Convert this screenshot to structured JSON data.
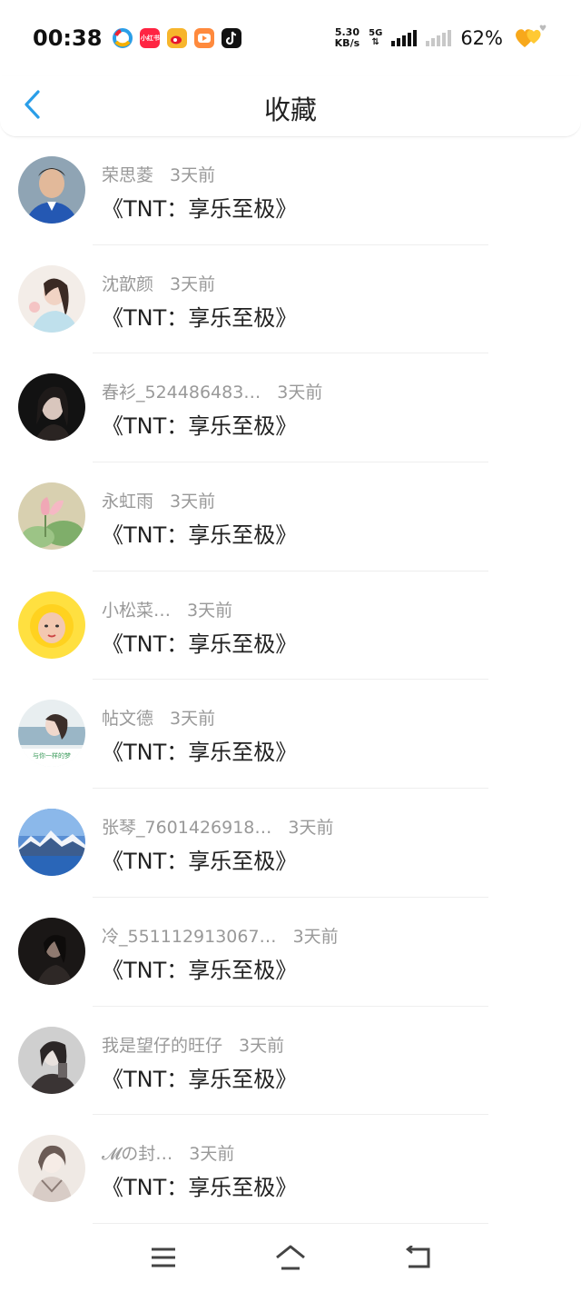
{
  "status_bar": {
    "time": "00:38",
    "net_speed_value": "5.30",
    "net_speed_unit": "KB/s",
    "network_type": "5G",
    "battery_percent": "62%",
    "notification_icons": [
      "browser-icon",
      "xiaohongshu-icon",
      "weibo-icon",
      "video-app-icon",
      "tiktok-icon"
    ],
    "notification_icon_labels": [
      "",
      "小红书",
      "",
      "",
      ""
    ]
  },
  "header": {
    "title": "收藏"
  },
  "items": [
    {
      "user": "荣思菱",
      "time": "3天前",
      "title": "《TNT：享乐至极》"
    },
    {
      "user": "沈歆颜",
      "time": "3天前",
      "title": "《TNT：享乐至极》"
    },
    {
      "user": "春衫_524486483…",
      "time": "3天前",
      "title": "《TNT：享乐至极》"
    },
    {
      "user": "永虹雨",
      "time": "3天前",
      "title": "《TNT：享乐至极》"
    },
    {
      "user": "小松菜…",
      "time": "3天前",
      "title": "《TNT：享乐至极》"
    },
    {
      "user": "帖文德",
      "time": "3天前",
      "title": "《TNT：享乐至极》"
    },
    {
      "user": "张琴_7601426918…",
      "time": "3天前",
      "title": "《TNT：享乐至极》"
    },
    {
      "user": "冷_551112913067…",
      "time": "3天前",
      "title": "《TNT：享乐至极》"
    },
    {
      "user": "我是望仔的旺仔",
      "time": "3天前",
      "title": "《TNT：享乐至极》"
    },
    {
      "user": "𝓜の封…",
      "time": "3天前",
      "title": "《TNT：享乐至极》"
    }
  ],
  "avatar_captions": {
    "6": "与你一样的梦"
  },
  "colors": {
    "accent": "#2a9ee8",
    "meta_text": "#999999",
    "title_text": "#222222"
  }
}
